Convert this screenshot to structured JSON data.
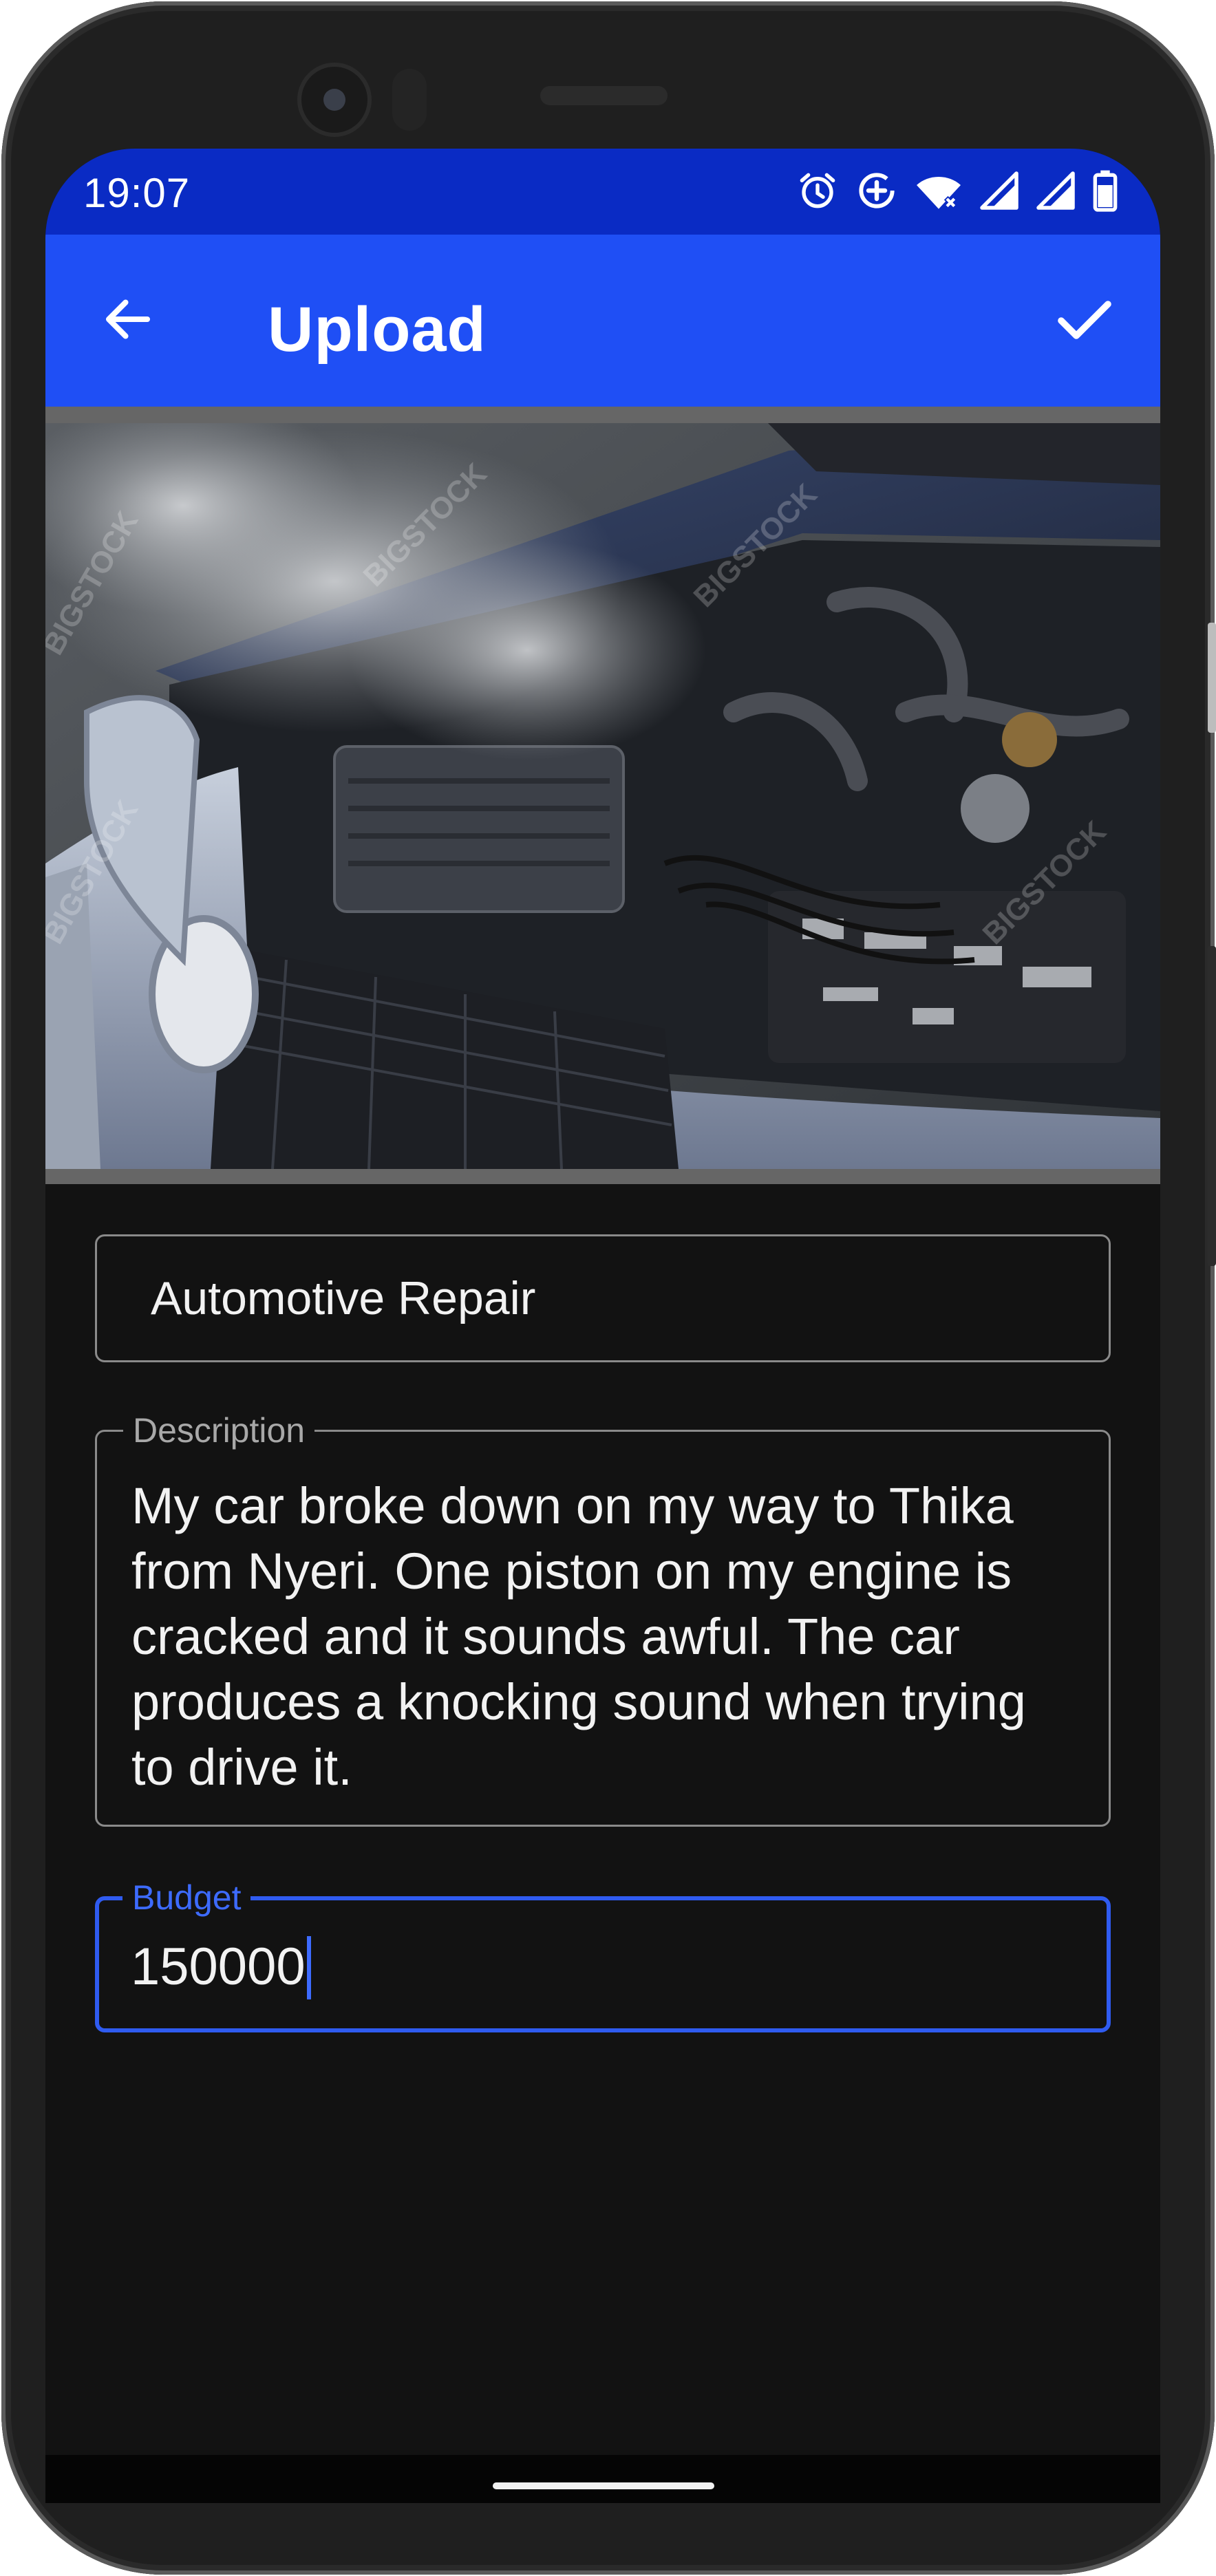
{
  "status_bar": {
    "time": "19:07",
    "icons": [
      "alarm-icon",
      "data-saver-icon",
      "wifi-icon",
      "signal-icon",
      "signal-icon",
      "battery-icon"
    ]
  },
  "app_bar": {
    "title": "Upload",
    "back_icon": "arrow-left-icon",
    "confirm_icon": "check-icon",
    "color": "#1f4ff5"
  },
  "form": {
    "title_value": "Automotive Repair",
    "description_label": "Description",
    "description_value": "My car broke down on my way to Thika from Nyeri. One piston on my engine is cracked and it sounds awful. The car produces a knocking sound when trying to drive it.",
    "budget_label": "Budget",
    "budget_value": "150000"
  },
  "photo": {
    "watermark": "BIGSTOCK"
  },
  "colors": {
    "status_bar": "#0a2bc4",
    "accent": "#2f5bf0",
    "background": "#121212"
  }
}
